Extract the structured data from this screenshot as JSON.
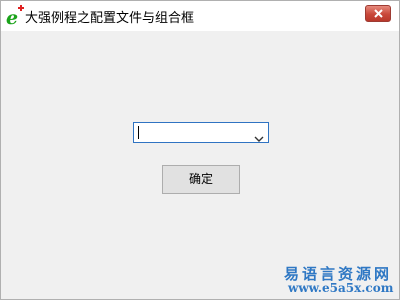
{
  "window": {
    "title": "大强例程之配置文件与组合框",
    "icon": "e-language-app-icon",
    "close_icon": "close-icon"
  },
  "combo": {
    "value": "",
    "icon": "chevron-down-icon"
  },
  "ok_button": {
    "label": "确定"
  },
  "watermark": {
    "site_name": "易语言资源网",
    "url": "www.e5a5x.com"
  },
  "colors": {
    "close_red": "#c9483a",
    "combo_border": "#2f73c2",
    "watermark_blue": "#2f78c4",
    "app_icon_green": "#1aa31a",
    "app_icon_red": "#e02020"
  }
}
